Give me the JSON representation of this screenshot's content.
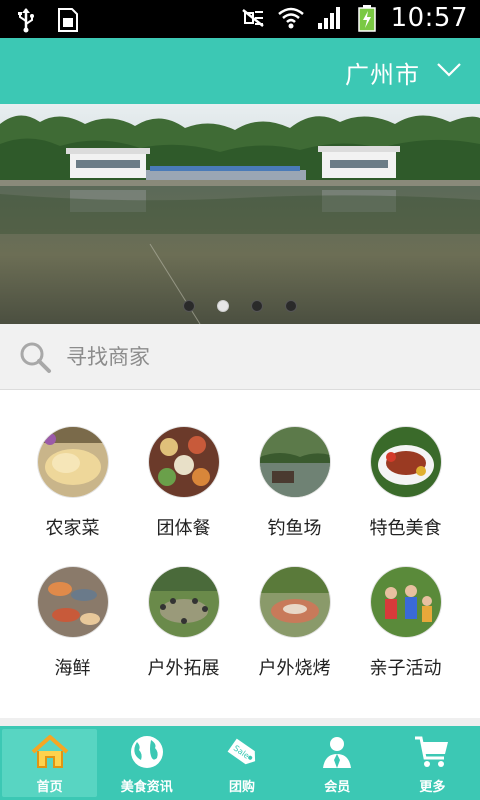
{
  "status_bar": {
    "time": "10:57",
    "icons": [
      "usb-icon",
      "sim-icon",
      "mute-icon",
      "wifi-icon",
      "signal-icon",
      "battery-charging-icon"
    ]
  },
  "header": {
    "city": "广州市",
    "accent_color": "#3cc8b4"
  },
  "banner": {
    "slide_count": 4,
    "active_slide": 2
  },
  "search": {
    "placeholder": "寻找商家"
  },
  "categories": [
    {
      "label": "农家菜",
      "icon": "farm-food-image"
    },
    {
      "label": "团体餐",
      "icon": "group-meal-image"
    },
    {
      "label": "钓鱼场",
      "icon": "fishing-pond-image"
    },
    {
      "label": "特色美食",
      "icon": "specialty-food-image"
    },
    {
      "label": "海鲜",
      "icon": "seafood-image"
    },
    {
      "label": "户外拓展",
      "icon": "outdoor-training-image"
    },
    {
      "label": "户外烧烤",
      "icon": "outdoor-bbq-image"
    },
    {
      "label": "亲子活动",
      "icon": "family-activity-image"
    }
  ],
  "tabbar": {
    "items": [
      {
        "label": "首页",
        "icon": "home-icon",
        "active": true
      },
      {
        "label": "美食资讯",
        "icon": "globe-icon",
        "active": false
      },
      {
        "label": "团购",
        "icon": "sale-tag-icon",
        "active": false
      },
      {
        "label": "会员",
        "icon": "member-icon",
        "active": false
      },
      {
        "label": "更多",
        "icon": "cart-icon",
        "active": false
      }
    ]
  }
}
